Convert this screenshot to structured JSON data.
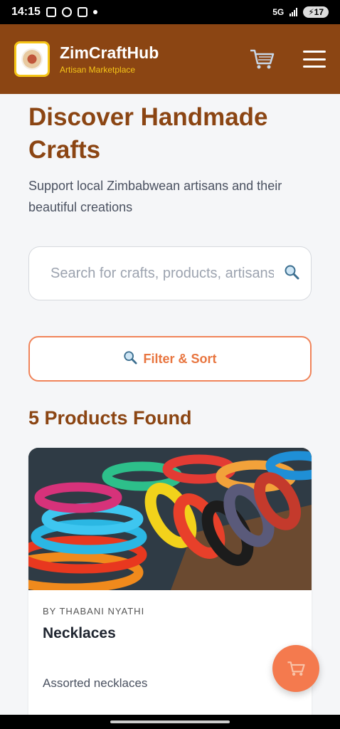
{
  "status_bar": {
    "time": "14:15",
    "network": "5G",
    "battery": "17"
  },
  "header": {
    "app_name": "ZimCraftHub",
    "tagline": "Artisan Marketplace",
    "cart_icon": "cart-icon",
    "menu_icon": "hamburger-menu-icon"
  },
  "hero": {
    "title": "Discover Handmade Crafts",
    "subtitle": "Support local Zimbabwean artisans and their beautiful creations"
  },
  "search": {
    "placeholder": "Search for crafts, products, artisans...",
    "icon": "search-icon"
  },
  "filter": {
    "label": "Filter & Sort",
    "icon": "search-icon"
  },
  "results": {
    "count_label": "5 Products Found"
  },
  "products": [
    {
      "by": "BY THABANI NYATHI",
      "name": "Necklaces",
      "description": "Assorted necklaces",
      "image_subject": "colorful beaded bracelets"
    }
  ],
  "colors": {
    "brand": "#8b4513",
    "accent": "#f47a4e",
    "gold": "#f5c518"
  }
}
